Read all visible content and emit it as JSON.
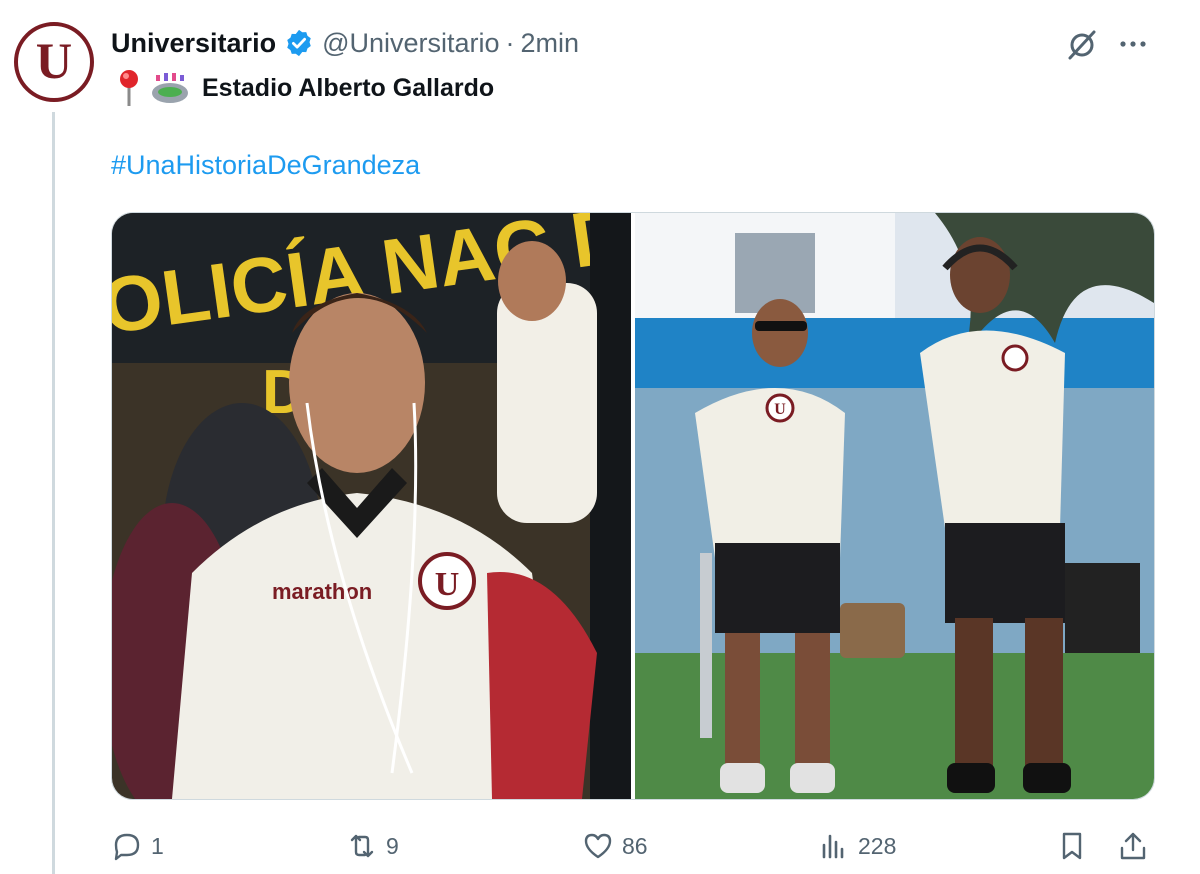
{
  "tweet": {
    "author_name": "Universitario",
    "handle": "@Universitario",
    "separator": "·",
    "time": "2min",
    "avatar_letter": "U",
    "location_text": "Estadio Alberto Gallardo",
    "hashtag": "#UnaHistoriaDeGrandeza"
  },
  "media": {
    "photo1_banner": "OLICÍA NAC D",
    "photo1_banner2": "D",
    "photo1_shirt_brand": "marathon",
    "photo1_crest": "U",
    "photo2_crest": "U"
  },
  "actions": {
    "replies": "1",
    "reposts": "9",
    "likes": "86",
    "views": "228"
  },
  "colors": {
    "brand": "#7a1c23",
    "link": "#1d9bf0",
    "muted": "#536471",
    "verified": "#1d9bf0"
  }
}
